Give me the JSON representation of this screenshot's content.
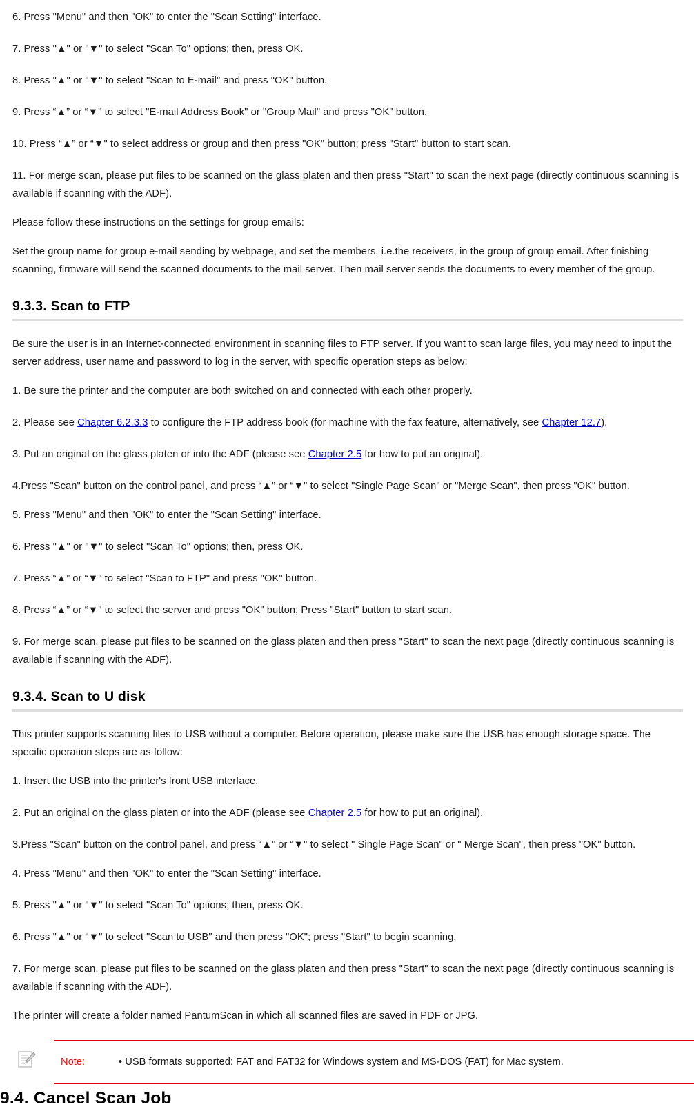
{
  "document": {
    "paragraphs_top": [
      "6. Press \"Menu\" and then \"OK\" to enter the \"Scan Setting\" interface.",
      "7. Press \"▲\" or \"▼\" to select \"Scan To\" options; then, press OK.",
      "8. Press \"▲\" or \"▼\" to select \"Scan to E-mail\" and press \"OK\" button.",
      "9. Press “▲” or “▼\" to select \"E-mail Address Book\" or \"Group Mail\" and press \"OK\" button.",
      "10. Press “▲” or “▼\" to select address or group and then press \"OK\" button; press \"Start\" button to start scan.",
      "11. For merge scan, please put files to be scanned on the glass platen and then press \"Start\" to scan the next page (directly continuous scanning is available if scanning with the ADF).",
      "Please follow these instructions on the settings for group emails:",
      "Set the group name for group e-mail sending by webpage, and set the members, i.e.the receivers, in the group of group email. After finishing scanning, firmware will send the scanned documents to the mail server. Then mail server sends the documents to every member of the group."
    ],
    "section_ftp": {
      "heading": "9.3.3. Scan to FTP",
      "intro": "Be sure the user is in an Internet-connected environment in scanning files to FTP server. If you want to scan large files, you may need to input the server address, user name and password to log in the server, with specific operation steps as below:",
      "step1": "1. Be sure the printer and the computer are both switched on and connected with each other properly.",
      "step2_a": "2. Please see ",
      "step2_link1": "Chapter 6.2.3.3",
      "step2_b": " to configure the FTP address book (for machine with the fax feature, alternatively, see ",
      "step2_link2": "Chapter 12.7",
      "step2_c": ").",
      "step3_a": "3. Put an original on the glass platen or into the ADF (please see ",
      "step3_link": "Chapter 2.5",
      "step3_b": " for how to put an original).",
      "step4": "4.Press \"Scan\" button on the control panel, and press “▲” or “▼\" to select \"Single Page Scan\" or \"Merge Scan\", then press \"OK\" button.",
      "step5": "5. Press \"Menu\" and then \"OK\" to enter the \"Scan Setting\" interface.",
      "step6": "6. Press \"▲\" or \"▼\" to select \"Scan To\" options; then, press OK.",
      "step7": "7. Press “▲” or “▼\" to select \"Scan to FTP\" and press \"OK\" button.",
      "step8": "8. Press “▲” or “▼\" to select the server and press \"OK\" button; Press \"Start\" button to start scan.",
      "step9": "9. For merge scan, please put files to be scanned on the glass platen and then press \"Start\" to scan the next page (directly continuous scanning is available if scanning with the ADF)."
    },
    "section_udisk": {
      "heading": "9.3.4. Scan to U disk",
      "intro": "This printer supports scanning files to USB without a computer. Before operation, please make sure the USB has enough storage space. The specific operation steps are as follow:",
      "step1": "1. Insert the USB into the printer's front USB interface.",
      "step2_a": "2. Put an original on the glass platen or into the ADF (please see ",
      "step2_link": "Chapter 2.5",
      "step2_b": " for how to put an original).",
      "step3": "3.Press \"Scan\" button on the control panel, and press “▲” or “▼\" to select \" Single Page Scan\" or \" Merge Scan\", then press \"OK\" button.",
      "step4": "4. Press \"Menu\" and then \"OK\" to enter the \"Scan Setting\" interface.",
      "step5": "5. Press \"▲\" or \"▼\" to select \"Scan To\" options; then, press OK.",
      "step6": "6. Press \"▲\" or \"▼\" to select \"Scan to USB\" and then press \"OK\"; press \"Start\" to begin scanning.",
      "step7": "7. For merge scan, please put files to be scanned on the glass platen and then press \"Start\" to scan the next page (directly continuous scanning is available if scanning with the ADF).",
      "folder_note": "The printer will create a folder named PantumScan in which all scanned files are saved in PDF or JPG."
    },
    "note": {
      "icon": "note-pencil-icon",
      "label": "Note:",
      "text": "• USB formats supported: FAT and FAT32 for Windows system and MS-DOS (FAT) for Mac system."
    },
    "bottom_heading": "9.4. Cancel Scan Job",
    "colors": {
      "link": "#0000cc",
      "note_red": "#ff0000",
      "rule_gray": "#dddddd",
      "text": "#1a1a1a"
    }
  }
}
